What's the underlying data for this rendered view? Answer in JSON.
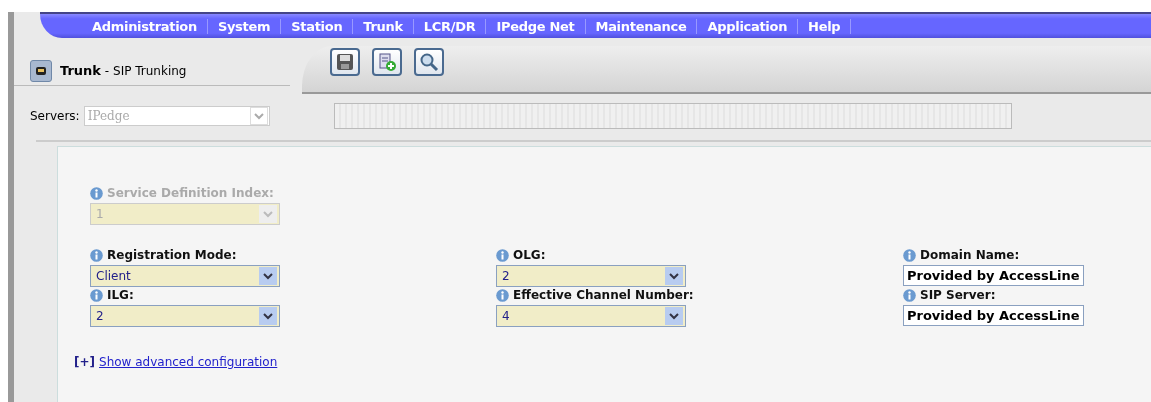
{
  "menu": [
    {
      "label": "Administration"
    },
    {
      "label": "System"
    },
    {
      "label": "Station"
    },
    {
      "label": "Trunk"
    },
    {
      "label": "LCR/DR"
    },
    {
      "label": "IPedge Net"
    },
    {
      "label": "Maintenance"
    },
    {
      "label": "Application"
    },
    {
      "label": "Help"
    }
  ],
  "page_title": {
    "section": "Trunk",
    "separator": "-",
    "subtitle": "SIP Trunking"
  },
  "toolbar": [
    {
      "kind": "save"
    },
    {
      "kind": "add"
    },
    {
      "kind": "search"
    }
  ],
  "servers": {
    "label": "Servers:",
    "value": "IPedge",
    "disabled": true
  },
  "form": {
    "rows": [
      [
        {
          "kind": "select",
          "label": "Service Definition Index:",
          "value": "1",
          "disabled": true
        },
        null,
        null
      ],
      [
        {
          "kind": "select",
          "label": "Registration Mode:",
          "value": "Client",
          "disabled": false
        },
        {
          "kind": "select",
          "label": "OLG:",
          "value": "2",
          "disabled": false
        },
        {
          "kind": "text",
          "label": "Domain Name:",
          "value": "Provided by AccessLine",
          "disabled": false
        }
      ],
      [
        {
          "kind": "select",
          "label": "ILG:",
          "value": "2",
          "disabled": false
        },
        {
          "kind": "select",
          "label": "Effective Channel Number:",
          "value": "4",
          "disabled": false
        },
        {
          "kind": "text",
          "label": "SIP Server:",
          "value": "Provided by AccessLine",
          "disabled": false
        }
      ]
    ],
    "advanced": {
      "marker": "[+]",
      "link": "Show advanced configuration"
    }
  }
}
